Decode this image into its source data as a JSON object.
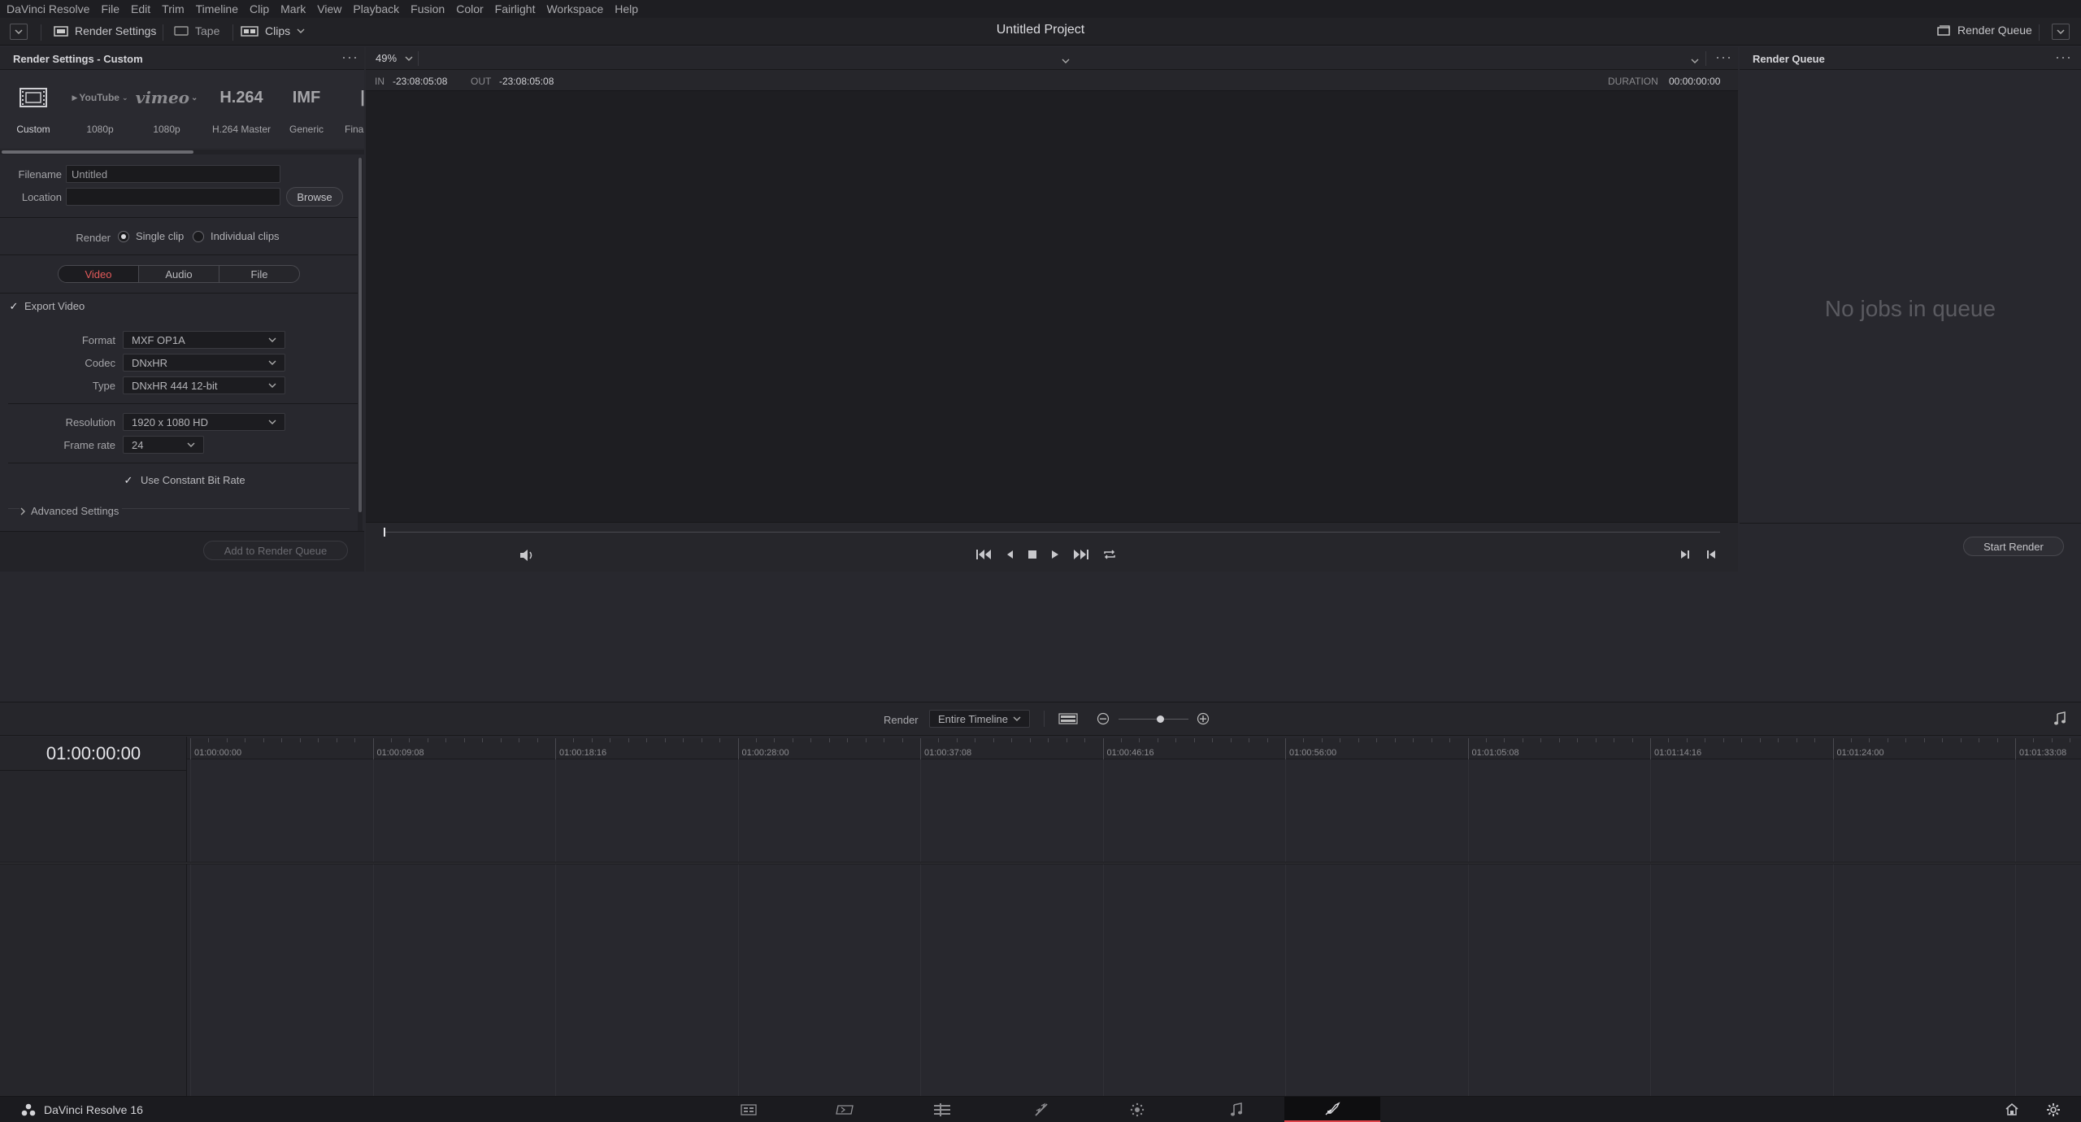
{
  "menubar": {
    "items": [
      "DaVinci Resolve",
      "File",
      "Edit",
      "Trim",
      "Timeline",
      "Clip",
      "Mark",
      "View",
      "Playback",
      "Fusion",
      "Color",
      "Fairlight",
      "Workspace",
      "Help"
    ]
  },
  "toolbar": {
    "render_settings": "Render Settings",
    "tape": "Tape",
    "clips": "Clips",
    "project_title": "Untitled Project",
    "render_queue": "Render Queue"
  },
  "render_settings": {
    "title": "Render Settings - Custom",
    "presets": [
      {
        "icon": "film-icon",
        "label": "Custom"
      },
      {
        "icon": "youtube-logo",
        "logo_text": "YouTube",
        "label": "1080p"
      },
      {
        "icon": "vimeo-logo",
        "logo_text": "vimeo",
        "label": "1080p"
      },
      {
        "icon": "h264-text",
        "logo_text": "H.264",
        "label": "H.264 Master"
      },
      {
        "icon": "imf-text",
        "logo_text": "IMF",
        "label": "Generic"
      },
      {
        "icon": "final-icon",
        "label": "Final"
      }
    ],
    "filename_label": "Filename",
    "filename_value": "Untitled",
    "location_label": "Location",
    "location_value": "",
    "browse": "Browse",
    "render_label": "Render",
    "single_clip": "Single clip",
    "individual_clips": "Individual clips",
    "tabs": [
      "Video",
      "Audio",
      "File"
    ],
    "active_tab": "Video",
    "export_video": "Export Video",
    "format_label": "Format",
    "format_value": "MXF OP1A",
    "codec_label": "Codec",
    "codec_value": "DNxHR",
    "type_label": "Type",
    "type_value": "DNxHR 444 12-bit",
    "resolution_label": "Resolution",
    "resolution_value": "1920 x 1080 HD",
    "framerate_label": "Frame rate",
    "framerate_value": "24",
    "constant_bitrate": "Use Constant Bit Rate",
    "advanced": "Advanced Settings",
    "add_to_queue": "Add to Render Queue"
  },
  "viewer": {
    "zoom": "49%",
    "in_label": "IN",
    "in_value": "-23:08:05:08",
    "out_label": "OUT",
    "out_value": "-23:08:05:08",
    "duration_label": "DURATION",
    "duration_value": "00:00:00:00"
  },
  "render_queue": {
    "title": "Render Queue",
    "empty": "No jobs in queue",
    "start": "Start Render"
  },
  "timeline": {
    "render_label": "Render",
    "render_value": "Entire Timeline",
    "timecode": "01:00:00:00",
    "ticks": [
      "01:00:00:00",
      "01:00:09:08",
      "01:00:18:16",
      "01:00:28:00",
      "01:00:37:08",
      "01:00:46:16",
      "01:00:56:00",
      "01:01:05:08",
      "01:01:14:16",
      "01:01:24:00",
      "01:01:33:08"
    ]
  },
  "statusbar": {
    "app": "DaVinci Resolve 16",
    "pages": [
      "media-page-icon",
      "cut-page-icon",
      "edit-page-icon",
      "fusion-page-icon",
      "color-page-icon",
      "fairlight-page-icon",
      "deliver-page-icon"
    ],
    "active_page": "deliver-page-icon"
  },
  "colors": {
    "accent_red": "#e0434a",
    "active_tab_text": "#e35a5a"
  }
}
